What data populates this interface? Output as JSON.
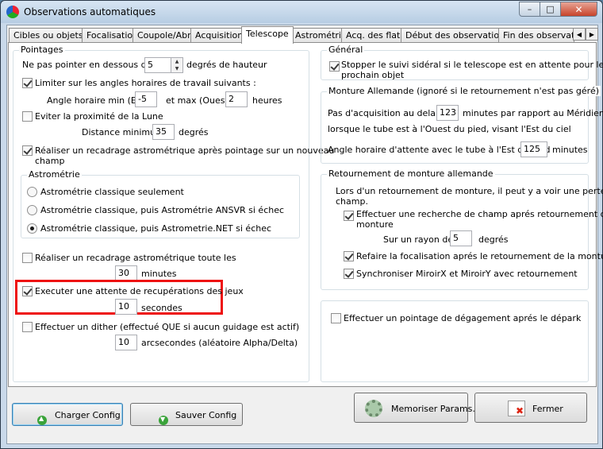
{
  "window": {
    "title": "Observations automatiques",
    "close_glyph": "✕",
    "min_glyph": "–",
    "max_glyph": "□"
  },
  "tabs": [
    "Cibles ou objets",
    "Focalisation",
    "Coupole/Abri",
    "Acquisition",
    "Telescope",
    "Astrométrie",
    "Acq. des flats",
    "Début des observations",
    "Fin des observatio"
  ],
  "tabs_active_index": 4,
  "tab_scroll": {
    "left": "◀",
    "right": "▶"
  },
  "pointages": {
    "title": "Pointages",
    "min_height": {
      "label_before": "Ne pas pointer en dessous de",
      "value": "5",
      "label_after": "degrés de hauteur"
    },
    "limit_hour": {
      "label": "Limiter sur les angles horaires de travail suivants :",
      "checked": true
    },
    "hour_angle": {
      "label_min": "Angle horaire min (Est)",
      "min_value": "-5",
      "label_max": "et max (Ouest)",
      "max_value": "2",
      "unit": "heures"
    },
    "avoid_moon": {
      "label": "Eviter la proximité de la Lune",
      "checked": false
    },
    "min_distance": {
      "label": "Distance minimum",
      "value": "35",
      "unit": "degrés"
    },
    "recenter": {
      "label_line1": "Réaliser un recadrage astrométrique après pointage sur un nouveau",
      "label_line2": "champ",
      "checked": true
    }
  },
  "astrometrie": {
    "title": "Astrométrie",
    "options": [
      {
        "label": "Astrométrie classique seulement",
        "checked": false
      },
      {
        "label": "Astrométrie classique, puis Astrométrie ANSVR si échec",
        "checked": false
      },
      {
        "label": "Astrométrie classique, puis Astrometrie.NET si échec",
        "checked": true
      }
    ]
  },
  "periodic_recenter": {
    "label": "Réaliser un recadrage astrométrique toute les",
    "checked": false,
    "value": "30",
    "unit": "minutes"
  },
  "wait_recovery": {
    "label": "Executer une attente de recupérations des jeux",
    "checked": true,
    "value": "10",
    "unit": "secondes"
  },
  "dither": {
    "label": "Effectuer un dither (effectué QUE si  aucun guidage est actif)",
    "checked": false,
    "value": "10",
    "unit": "arcsecondes (aléatoire Alpha/Delta)"
  },
  "general": {
    "title": "Général",
    "stop_tracking": {
      "label_line1": "Stopper le suivi sidéral si le telescope est en attente pour le",
      "label_line2": "prochain objet",
      "checked": true
    }
  },
  "monture": {
    "title": "Monture Allemande (ignoré si le retournement n'est pas géré)",
    "line1_before": "Pas d'acquisition au dela de",
    "line1_value": "123",
    "line1_after": "minutes par rapport au Méridien",
    "line2": "lorsque le tube est à l'Ouest du pied, visant l'Est du ciel",
    "line3_before": "Angle horaire d'attente avec le tube à l'Est du pied",
    "line3_value": "125",
    "line3_after": "minutes"
  },
  "retournement": {
    "title": "Retournement de monture allemande",
    "intro_line1": "Lors d'un retournement de monture, il peut y a voir une perte du",
    "intro_line2": "champ.",
    "search": {
      "label_line1": "Effectuer une recherche de champ aprés retournement de",
      "label_line2": "monture",
      "checked": true
    },
    "radius": {
      "label": "Sur un rayon de",
      "value": "5",
      "unit": "degrés"
    },
    "refocus": {
      "label": "Refaire la focalisation aprés le retournement de la monture",
      "checked": true
    },
    "sync": {
      "label": "Synchroniser MiroirX et MiroirY avec retournement",
      "checked": true
    }
  },
  "departure": {
    "label": "Effectuer un pointage de dégagement aprés le dépark",
    "checked": false
  },
  "buttons": {
    "load": "Charger Config",
    "save": "Sauver Config",
    "memorize": "Memoriser Params.",
    "close": "Fermer"
  }
}
